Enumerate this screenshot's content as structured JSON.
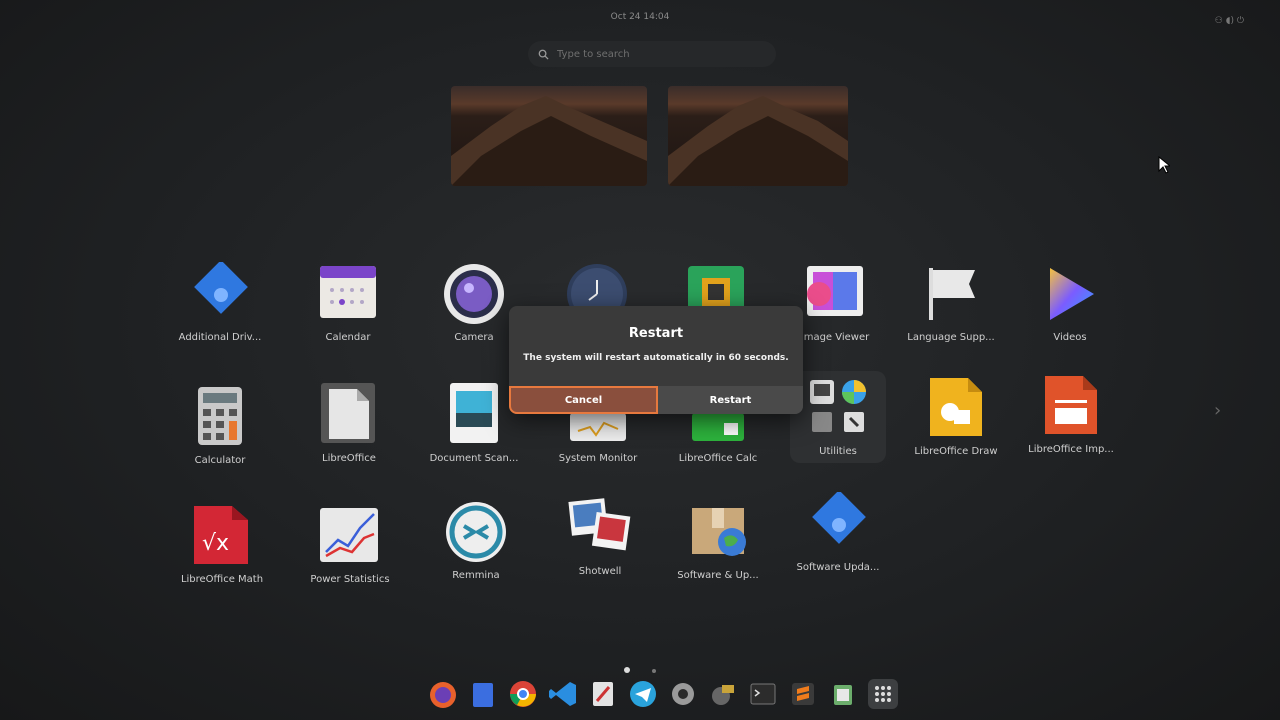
{
  "topbar": {
    "clock": "Oct 24  14:04"
  },
  "search": {
    "placeholder": "Type to search"
  },
  "apps": [
    {
      "label": "Additional Driv..."
    },
    {
      "label": "Calendar"
    },
    {
      "label": "Camera"
    },
    {
      "label": "Image Viewer"
    },
    {
      "label": "Language Supp..."
    },
    {
      "label": "Videos"
    },
    {
      "label": "Calculator"
    },
    {
      "label": "LibreOffice"
    },
    {
      "label": "Document Scan..."
    },
    {
      "label": "System Monitor"
    },
    {
      "label": "LibreOffice Calc"
    },
    {
      "label": "Utilities"
    },
    {
      "label": "LibreOffice Draw"
    },
    {
      "label": "LibreOffice Imp..."
    },
    {
      "label": "LibreOffice Math"
    },
    {
      "label": "Power Statistics"
    },
    {
      "label": "Remmina"
    },
    {
      "label": "Shotwell"
    },
    {
      "label": "Software & Up..."
    },
    {
      "label": "Software Upda..."
    }
  ],
  "dialog": {
    "title": "Restart",
    "message": "The system will restart automatically in 60 seconds.",
    "cancel": "Cancel",
    "restart": "Restart"
  },
  "dock": [
    "firefox-icon",
    "files-icon",
    "chrome-icon",
    "vscode-icon",
    "text-editor-icon",
    "telegram-icon",
    "settings-icon",
    "workspace-icon",
    "terminal-icon",
    "sublime-icon",
    "trash-icon",
    "app-grid-icon"
  ]
}
